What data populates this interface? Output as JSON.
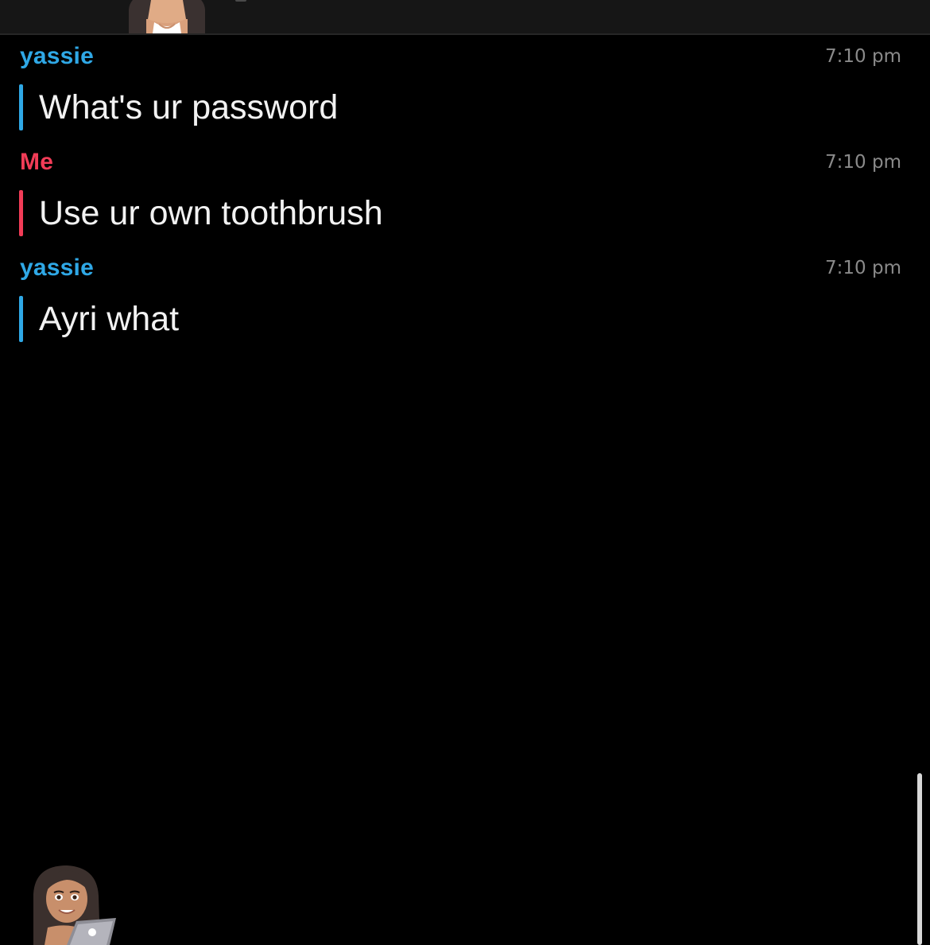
{
  "colors": {
    "background": "#000000",
    "friend": "#2fa8e6",
    "me": "#f23c57",
    "message_text": "#f2f2f2",
    "timestamp": "#8a8a8a"
  },
  "header": {
    "avatar_icon": "bitmoji-avatar-icon"
  },
  "messages": [
    {
      "sender": "yassie",
      "time": "7:10 pm",
      "text": "What's ur password",
      "from": "friend"
    },
    {
      "sender": "Me",
      "time": "7:10 pm",
      "text": "Use ur own toothbrush",
      "from": "me"
    },
    {
      "sender": "yassie",
      "time": "7:10 pm",
      "text": "Ayri what",
      "from": "friend"
    }
  ],
  "footer": {
    "bitmoji_icon": "bitmoji-laptop-icon"
  }
}
